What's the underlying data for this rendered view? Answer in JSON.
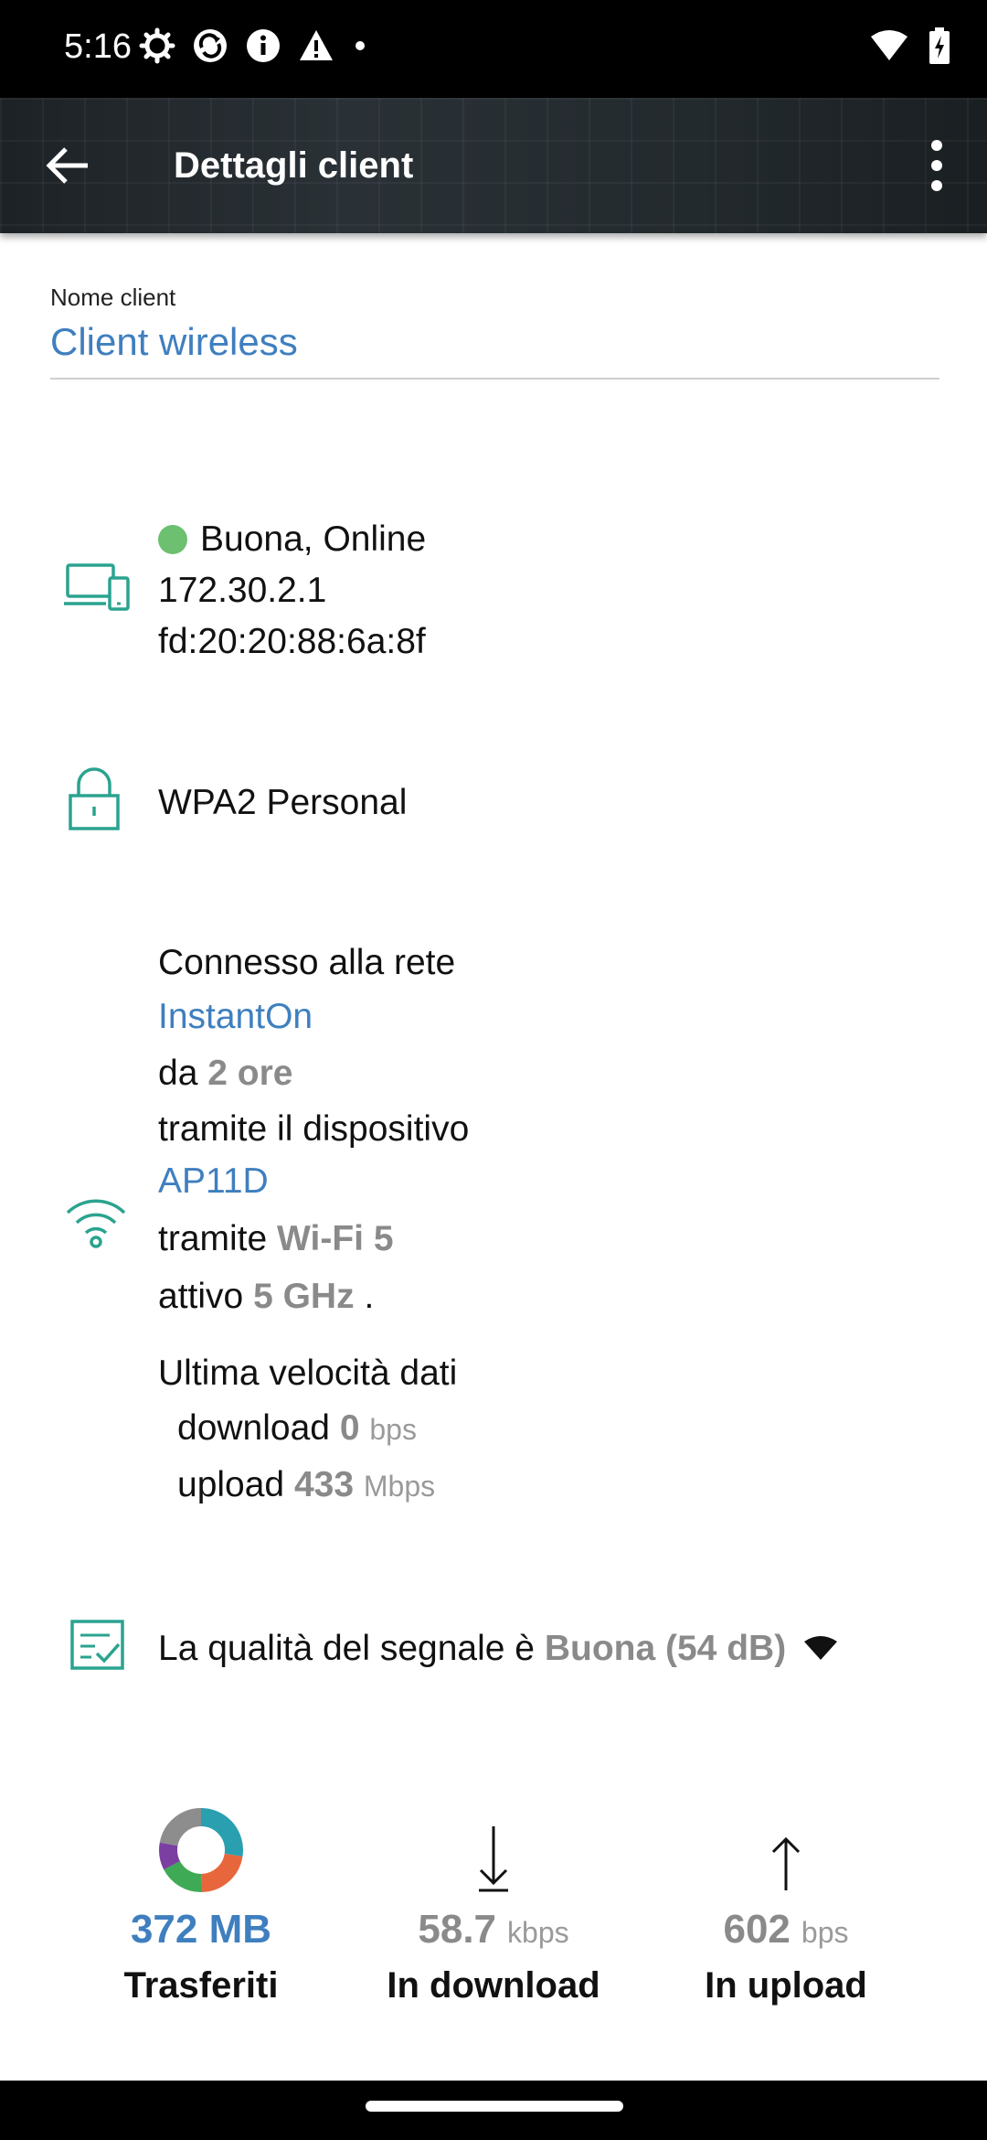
{
  "status": {
    "time": "5:16"
  },
  "appbar": {
    "title": "Dettagli client"
  },
  "client_name": {
    "label": "Nome client",
    "value": "Client wireless"
  },
  "status_section": {
    "health": "Buona, Online",
    "ipv4": "172.30.2.1",
    "ipv6": "fd:20:20:88:6a:8f"
  },
  "security": {
    "type": "WPA2 Personal"
  },
  "connection": {
    "line1": "Connesso alla rete",
    "network": "InstantOn",
    "since_prefix": "da",
    "since_value": "2 ore",
    "device_prefix": "tramite il dispositivo",
    "device": "AP11D",
    "via_prefix": "tramite",
    "via_value": "Wi-Fi 5",
    "band_prefix": "attivo",
    "band_value": "5 GHz",
    "band_suffix": "."
  },
  "speed": {
    "title": "Ultima velocità dati",
    "download_label": "download",
    "download_value": "0",
    "download_unit": "bps",
    "upload_label": "upload",
    "upload_value": "433",
    "upload_unit": "Mbps"
  },
  "signal": {
    "prefix": "La qualità del segnale è",
    "value": "Buona (54 dB)"
  },
  "stats": {
    "transferred": {
      "value": "372 MB",
      "label": "Trasferiti"
    },
    "download": {
      "value": "58.7",
      "unit": "kbps",
      "label": "In download"
    },
    "upload": {
      "value": "602",
      "unit": "bps",
      "label": "In upload"
    }
  },
  "colors": {
    "accent_blue": "#3f7fbf",
    "icon_teal": "#2aa38f",
    "online_green": "#6cc070",
    "donut": [
      "#2a9fb0",
      "#e8663c",
      "#3faa55",
      "#7a3fa0",
      "#8d8d8d"
    ]
  },
  "icons": [
    "gear-icon",
    "sync-icon",
    "info-icon",
    "warning-icon",
    "wifi-icon",
    "battery-icon",
    "back-arrow-icon",
    "more-vert-icon",
    "devices-icon",
    "lock-icon",
    "wifi-signal-icon",
    "checklist-icon",
    "donut-chart-icon",
    "download-arrow-icon",
    "upload-arrow-icon"
  ]
}
